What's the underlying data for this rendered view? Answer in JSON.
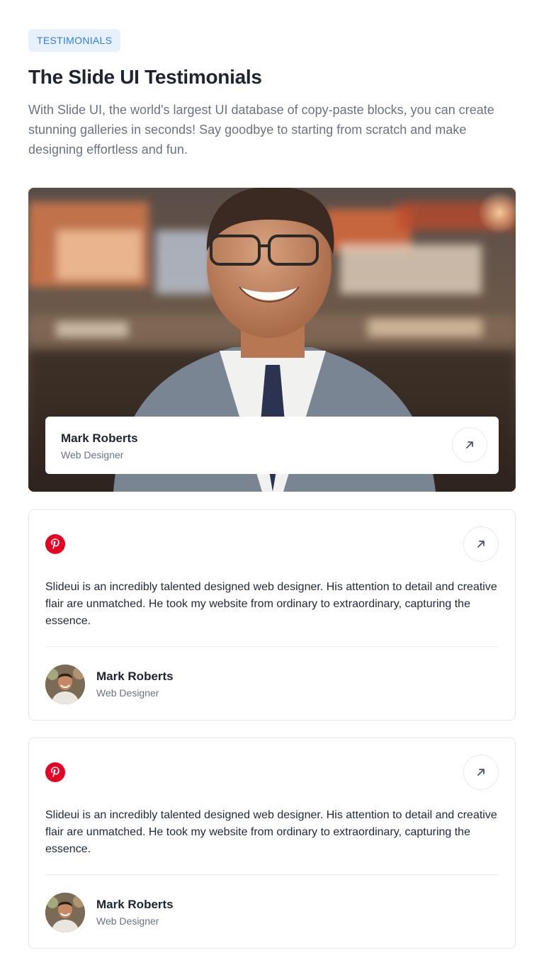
{
  "header": {
    "badge": "TESTIMONIALS",
    "title": "The Slide UI Testimonials",
    "description": "With Slide UI, the world's largest UI database of copy-paste blocks, you can create stunning galleries in seconds! Say goodbye to starting from scratch and make designing effortless and fun."
  },
  "featured": {
    "name": "Mark Roberts",
    "role": "Web Designer",
    "icon": "arrow-up-right-icon"
  },
  "testimonials": [
    {
      "brand_icon": "pinterest-icon",
      "quote": "Slideui is an incredibly talented designed web designer. His attention to detail and creative flair are unmatched. He took my website from ordinary to extraordinary, capturing the essence.",
      "name": "Mark Roberts",
      "role": "Web Designer"
    },
    {
      "brand_icon": "pinterest-icon",
      "quote": "Slideui is an incredibly talented designed web designer. His attention to detail and creative flair are unmatched. He took my website from ordinary to extraordinary, capturing the essence.",
      "name": "Mark Roberts",
      "role": "Web Designer"
    }
  ],
  "colors": {
    "badge_bg": "#e6f1fd",
    "badge_text": "#2f80d8",
    "pinterest": "#e60023",
    "border": "#e5e7eb"
  }
}
